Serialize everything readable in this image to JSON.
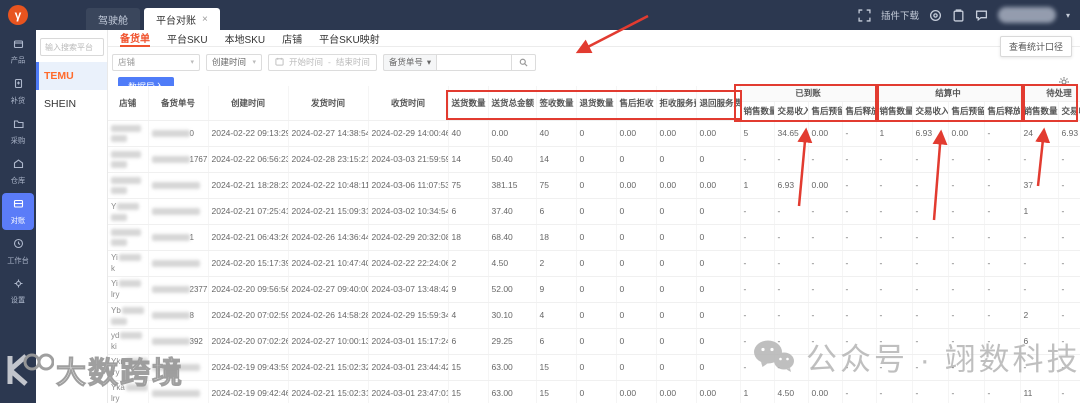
{
  "topbar": {
    "window_tabs": [
      {
        "key": "cockpit",
        "label": "驾驶舱",
        "active": false,
        "closable": false
      },
      {
        "key": "platform-reconcile",
        "label": "平台对账",
        "active": true,
        "closable": true
      }
    ],
    "plugin_download": "插件下载",
    "close_glyph": "×",
    "chevron_glyph": "▾"
  },
  "sidebar": {
    "items": [
      {
        "key": "product",
        "label": "产品",
        "icon": "product-icon",
        "active": false
      },
      {
        "key": "replenish",
        "label": "补货",
        "icon": "replenish-icon",
        "active": false
      },
      {
        "key": "purchase",
        "label": "采购",
        "icon": "purchase-icon",
        "active": false
      },
      {
        "key": "warehouse",
        "label": "仓库",
        "icon": "warehouse-icon",
        "active": false
      },
      {
        "key": "reconcile",
        "label": "对账",
        "icon": "reconcile-icon",
        "active": true
      },
      {
        "key": "workbench",
        "label": "工作台",
        "icon": "workbench-icon",
        "active": false
      },
      {
        "key": "settings",
        "label": "设置",
        "icon": "settings-icon",
        "active": false
      }
    ]
  },
  "platform_panel": {
    "search_placeholder": "输入搜索平台",
    "items": [
      {
        "name": "TEMU",
        "active": true
      },
      {
        "name": "SHEIN",
        "active": false
      }
    ]
  },
  "main": {
    "tabs": [
      {
        "key": "stock-order",
        "label": "备货单",
        "active": true
      },
      {
        "key": "platform-sku",
        "label": "平台SKU",
        "active": false
      },
      {
        "key": "local-sku",
        "label": "本地SKU",
        "active": false
      },
      {
        "key": "shop",
        "label": "店铺",
        "active": false
      },
      {
        "key": "platform-sku-mapping",
        "label": "平台SKU映射",
        "active": false
      }
    ],
    "view_stat_button": "查看统计口径",
    "filters": {
      "shop_placeholder": "店铺",
      "time_type": "创建时间",
      "start_placeholder": "开始时间",
      "separator": "-",
      "end_placeholder": "结束时间",
      "order_type": "备货单号"
    },
    "import_button": "数据导入",
    "table": {
      "columns": [
        "店铺",
        "备货单号",
        "创建时间",
        "发货时间",
        "收货时间",
        "送货数量",
        "送货总金额",
        "签收数量",
        "退货数量",
        "售后拒收",
        "拒收服务费",
        "退回服务费"
      ],
      "groups": [
        {
          "key": "paid",
          "title": "已到账",
          "columns": [
            "销售数量",
            "交易收入",
            "售后预留",
            "售后释放"
          ]
        },
        {
          "key": "settling",
          "title": "结算中",
          "columns": [
            "销售数量",
            "交易收入",
            "售后预留",
            "售后释放"
          ]
        },
        {
          "key": "pending",
          "title": "待处理",
          "columns": [
            "销售数量",
            "交易收入"
          ]
        }
      ],
      "rows": [
        {
          "store_hint": [
            "",
            ""
          ],
          "order_suffix": "0",
          "created": "2024-02-22 09:13:29",
          "shipped": "2024-02-27 14:38:54",
          "received": "2024-02-29 14:00:46",
          "values": [
            "40",
            "0.00",
            "40",
            "0",
            "0.00",
            "0.00",
            "0.00"
          ],
          "paid": [
            "5",
            "34.65",
            "0.00",
            "-"
          ],
          "settling": [
            "1",
            "6.93",
            "0.00",
            "-"
          ],
          "pending": [
            "24",
            "6.93"
          ]
        },
        {
          "store_hint": [
            "",
            ""
          ],
          "order_suffix": "1767",
          "created": "2024-02-22 06:56:23",
          "shipped": "2024-02-28 23:15:21",
          "received": "2024-03-03 21:59:59",
          "values": [
            "14",
            "50.40",
            "14",
            "0",
            "0",
            "0",
            "0"
          ],
          "paid": [
            "-",
            "-",
            "-",
            "-"
          ],
          "settling": [
            "-",
            "-",
            "-",
            "-"
          ],
          "pending": [
            "-",
            "-"
          ]
        },
        {
          "store_hint": [
            "",
            ""
          ],
          "order_suffix": "",
          "created": "2024-02-21 18:28:23",
          "shipped": "2024-02-22 10:48:11",
          "received": "2024-03-06 11:07:53",
          "values": [
            "75",
            "381.15",
            "75",
            "0",
            "0.00",
            "0.00",
            "0.00"
          ],
          "paid": [
            "1",
            "6.93",
            "0.00",
            "-"
          ],
          "settling": [
            "-",
            "-",
            "-",
            "-"
          ],
          "pending": [
            "37",
            "-"
          ]
        },
        {
          "store_hint": [
            "Y",
            ""
          ],
          "order_suffix": "",
          "created": "2024-02-21 07:25:41",
          "shipped": "2024-02-21 15:09:31",
          "received": "2024-03-02 10:34:54",
          "values": [
            "6",
            "37.40",
            "6",
            "0",
            "0",
            "0",
            "0"
          ],
          "paid": [
            "-",
            "-",
            "-",
            "-"
          ],
          "settling": [
            "-",
            "-",
            "-",
            "-"
          ],
          "pending": [
            "1",
            "-"
          ]
        },
        {
          "store_hint": [
            "",
            ""
          ],
          "order_suffix": "1",
          "created": "2024-02-21 06:43:26",
          "shipped": "2024-02-26 14:36:44",
          "received": "2024-02-29 20:32:08",
          "values": [
            "18",
            "68.40",
            "18",
            "0",
            "0",
            "0",
            "0"
          ],
          "paid": [
            "-",
            "-",
            "-",
            "-"
          ],
          "settling": [
            "-",
            "-",
            "-",
            "-"
          ],
          "pending": [
            "-",
            "-"
          ]
        },
        {
          "store_hint": [
            "Yi",
            "k"
          ],
          "order_suffix": "",
          "created": "2024-02-20 15:17:39",
          "shipped": "2024-02-21 10:47:40",
          "received": "2024-02-22 22:24:06",
          "values": [
            "2",
            "4.50",
            "2",
            "0",
            "0",
            "0",
            "0"
          ],
          "paid": [
            "-",
            "-",
            "-",
            "-"
          ],
          "settling": [
            "-",
            "-",
            "-",
            "-"
          ],
          "pending": [
            "-",
            "-"
          ]
        },
        {
          "store_hint": [
            "Yi",
            "lry"
          ],
          "order_suffix": "2377",
          "created": "2024-02-20 09:56:56",
          "shipped": "2024-02-27 09:40:00",
          "received": "2024-03-07 13:48:42",
          "values": [
            "9",
            "52.00",
            "9",
            "0",
            "0",
            "0",
            "0"
          ],
          "paid": [
            "-",
            "-",
            "-",
            "-"
          ],
          "settling": [
            "-",
            "-",
            "-",
            "-"
          ],
          "pending": [
            "-",
            "-"
          ]
        },
        {
          "store_hint": [
            "Yb",
            ""
          ],
          "order_suffix": "8",
          "created": "2024-02-20 07:02:59",
          "shipped": "2024-02-26 14:58:28",
          "received": "2024-02-29 15:59:34",
          "values": [
            "4",
            "30.10",
            "4",
            "0",
            "0",
            "0",
            "0"
          ],
          "paid": [
            "-",
            "-",
            "-",
            "-"
          ],
          "settling": [
            "-",
            "-",
            "-",
            "-"
          ],
          "pending": [
            "2",
            "-"
          ]
        },
        {
          "store_hint": [
            "yd",
            "ki"
          ],
          "order_suffix": "392",
          "created": "2024-02-20 07:02:26",
          "shipped": "2024-02-27 10:00:13",
          "received": "2024-03-01 15:17:24",
          "values": [
            "6",
            "29.25",
            "6",
            "0",
            "0",
            "0",
            "0"
          ],
          "paid": [
            "-",
            "-",
            "-",
            "-"
          ],
          "settling": [
            "-",
            "-",
            "-",
            "-"
          ],
          "pending": [
            "6",
            "-"
          ]
        },
        {
          "store_hint": [
            "Ykn",
            "lry"
          ],
          "order_suffix": "",
          "created": "2024-02-19 09:43:59",
          "shipped": "2024-02-21 15:02:32",
          "received": "2024-03-01 23:44:42",
          "values": [
            "15",
            "63.00",
            "15",
            "0",
            "0",
            "0",
            "0"
          ],
          "paid": [
            "-",
            "-",
            "-",
            "-"
          ],
          "settling": [
            "-",
            "-",
            "-",
            "-"
          ],
          "pending": [
            "-",
            "-"
          ]
        },
        {
          "store_hint": [
            "Yka",
            "lry"
          ],
          "order_suffix": "",
          "created": "2024-02-19 09:42:46",
          "shipped": "2024-02-21 15:02:31",
          "received": "2024-03-01 23:47:01",
          "values": [
            "15",
            "63.00",
            "15",
            "0",
            "0.00",
            "0.00",
            "0.00"
          ],
          "paid": [
            "1",
            "4.50",
            "0.00",
            "-"
          ],
          "settling": [
            "-",
            "-",
            "-",
            "-"
          ],
          "pending": [
            "11",
            "-"
          ]
        }
      ]
    }
  },
  "watermarks": {
    "wechat": "公众号 · 翊数科技",
    "brand": "大数跨境"
  },
  "colors": {
    "topbar_bg": "#2c3850",
    "sidebar_active": "#5b7cf8",
    "primary_button": "#4f7cf8",
    "active_tab": "#f0532e",
    "temu_orange": "#ff6a2b",
    "annotation_red": "#e23b30"
  }
}
